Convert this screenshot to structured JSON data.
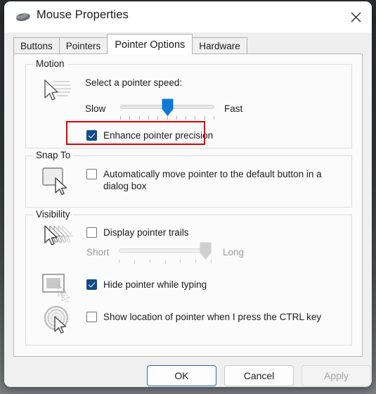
{
  "window": {
    "title": "Mouse Properties",
    "icon": "mouse-icon",
    "close_label": "Close"
  },
  "tabs": [
    {
      "label": "Buttons",
      "active": false
    },
    {
      "label": "Pointers",
      "active": false
    },
    {
      "label": "Pointer Options",
      "active": true
    },
    {
      "label": "Hardware",
      "active": false
    }
  ],
  "motion": {
    "group_title": "Motion",
    "speed_label": "Select a pointer speed:",
    "slow_label": "Slow",
    "fast_label": "Fast",
    "slider_value": 50,
    "slider_min": 0,
    "slider_max": 100,
    "tick_count": 11,
    "enhance_precision": {
      "label": "Enhance pointer precision",
      "checked": true
    }
  },
  "snap_to": {
    "group_title": "Snap To",
    "auto_move": {
      "label": "Automatically move pointer to the default button in a dialog box",
      "checked": false
    }
  },
  "visibility": {
    "group_title": "Visibility",
    "pointer_trails": {
      "label": "Display pointer trails",
      "checked": false
    },
    "trails_short_label": "Short",
    "trails_long_label": "Long",
    "trails_slider_value": 88,
    "trails_tick_count": 7,
    "trails_disabled": true,
    "hide_while_typing": {
      "label": "Hide pointer while typing",
      "checked": true
    },
    "show_location": {
      "label": "Show location of pointer when I press the CTRL key",
      "checked": false
    }
  },
  "footer": {
    "ok_label": "OK",
    "cancel_label": "Cancel",
    "apply_label": "Apply",
    "apply_disabled": true
  },
  "annotation": {
    "color": "#e00000",
    "target": "enhance-pointer-precision-checkbox"
  },
  "colors": {
    "accent_checkbox": "#0f4c8a",
    "slider_thumb": "#0e7ad4",
    "default_button_border": "#2b6aa8",
    "annotation_red": "#e00000"
  }
}
